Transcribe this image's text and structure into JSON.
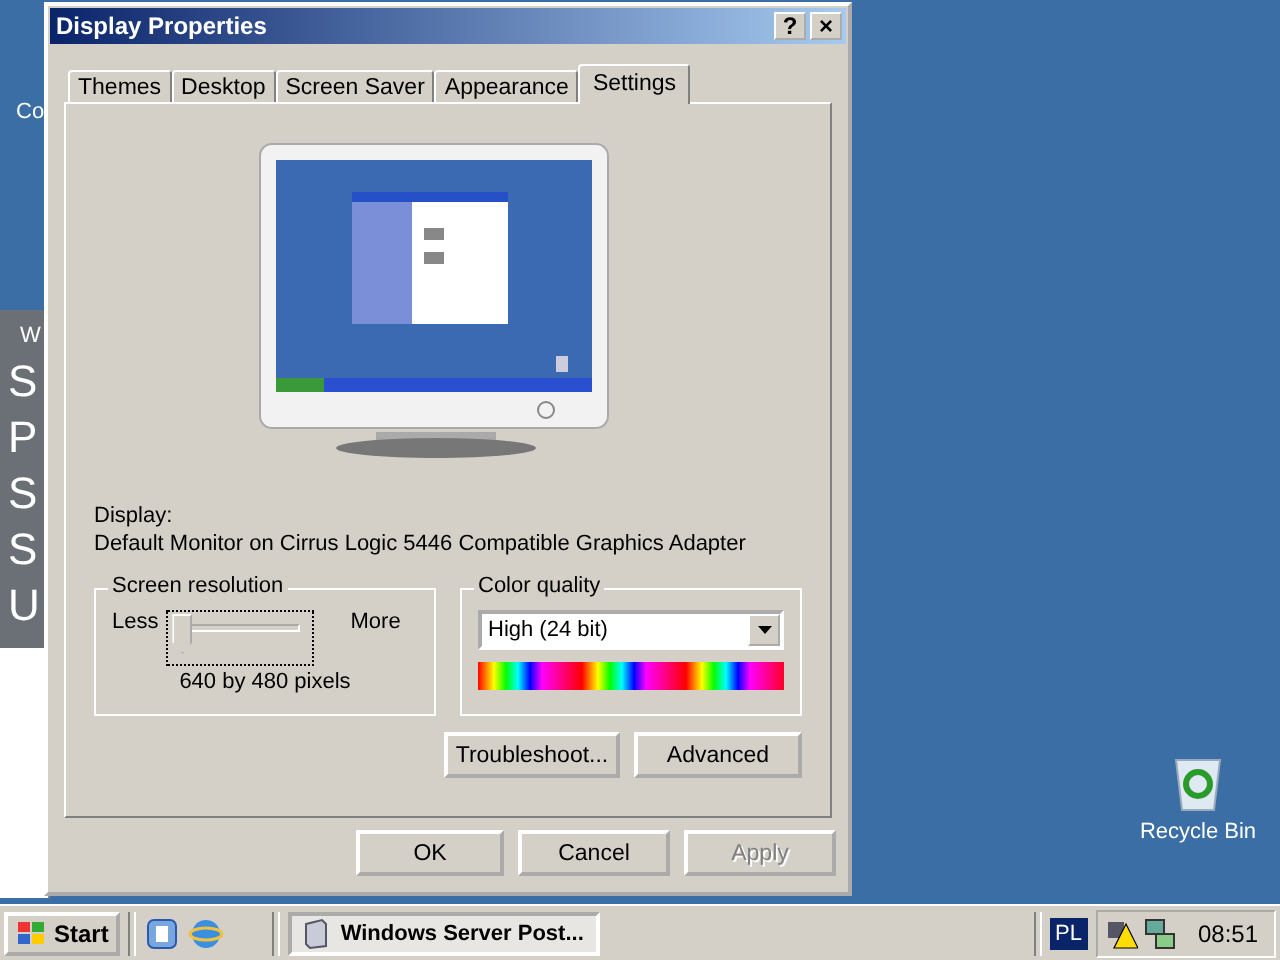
{
  "desktop": {
    "icon_label_fragment": "Co",
    "recycle_bin": "Recycle Bin"
  },
  "background_window": {
    "fragments": [
      "W",
      "S",
      "P",
      "S",
      "S",
      "U"
    ]
  },
  "window": {
    "title": "Display Properties",
    "help": "?",
    "close": "×"
  },
  "tabs": [
    {
      "label": "Themes",
      "selected": false
    },
    {
      "label": "Desktop",
      "selected": false
    },
    {
      "label": "Screen Saver",
      "selected": false
    },
    {
      "label": "Appearance",
      "selected": false
    },
    {
      "label": "Settings",
      "selected": true
    }
  ],
  "display": {
    "label": "Display:",
    "device": "Default Monitor on Cirrus Logic 5446 Compatible Graphics Adapter"
  },
  "screen_resolution": {
    "title": "Screen resolution",
    "less": "Less",
    "more": "More",
    "level": 0,
    "reading": "640 by 480 pixels"
  },
  "color_quality": {
    "title": "Color quality",
    "value": "High (24 bit)"
  },
  "panel_buttons": [
    {
      "label": "Troubleshoot...",
      "disabled": false
    },
    {
      "label": "Advanced",
      "disabled": false
    }
  ],
  "dialog_buttons": [
    {
      "label": "OK",
      "disabled": false
    },
    {
      "label": "Cancel",
      "disabled": false
    },
    {
      "label": "Apply",
      "disabled": true
    }
  ],
  "taskbar": {
    "start": "Start",
    "task": "Windows Server Post...",
    "language": "PL",
    "clock": "08:51"
  }
}
